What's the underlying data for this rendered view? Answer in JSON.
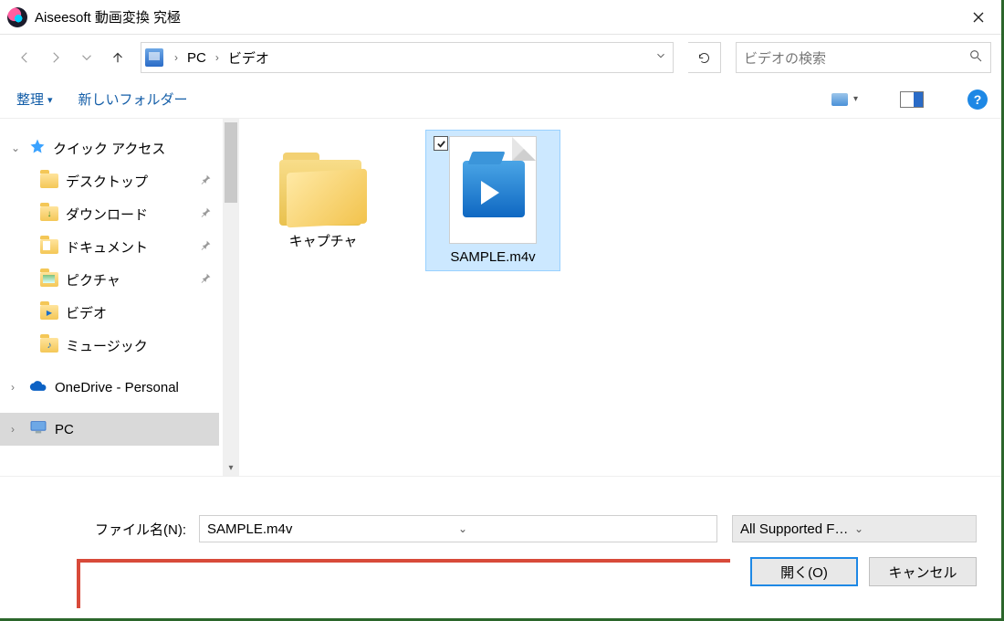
{
  "title": "Aiseesoft 動画変換 究極",
  "breadcrumb": {
    "root": "PC",
    "folder": "ビデオ"
  },
  "search": {
    "placeholder": "ビデオの検索"
  },
  "toolbar": {
    "organize": "整理",
    "new_folder": "新しいフォルダー"
  },
  "sidebar": {
    "quick_access": "クイック アクセス",
    "items": [
      {
        "label": "デスクトップ",
        "pinned": true
      },
      {
        "label": "ダウンロード",
        "pinned": true
      },
      {
        "label": "ドキュメント",
        "pinned": true
      },
      {
        "label": "ピクチャ",
        "pinned": true
      },
      {
        "label": "ビデオ",
        "pinned": false
      },
      {
        "label": "ミュージック",
        "pinned": false
      }
    ],
    "onedrive": "OneDrive - Personal",
    "pc": "PC"
  },
  "files": {
    "folder1": "キャプチャ",
    "video1": "SAMPLE.m4v"
  },
  "bottom": {
    "filename_label": "ファイル名(N):",
    "filename_value": "SAMPLE.m4v",
    "filter": "All Supported Formats (*.ts;*.mts",
    "open": "開く(O)",
    "cancel": "キャンセル"
  }
}
